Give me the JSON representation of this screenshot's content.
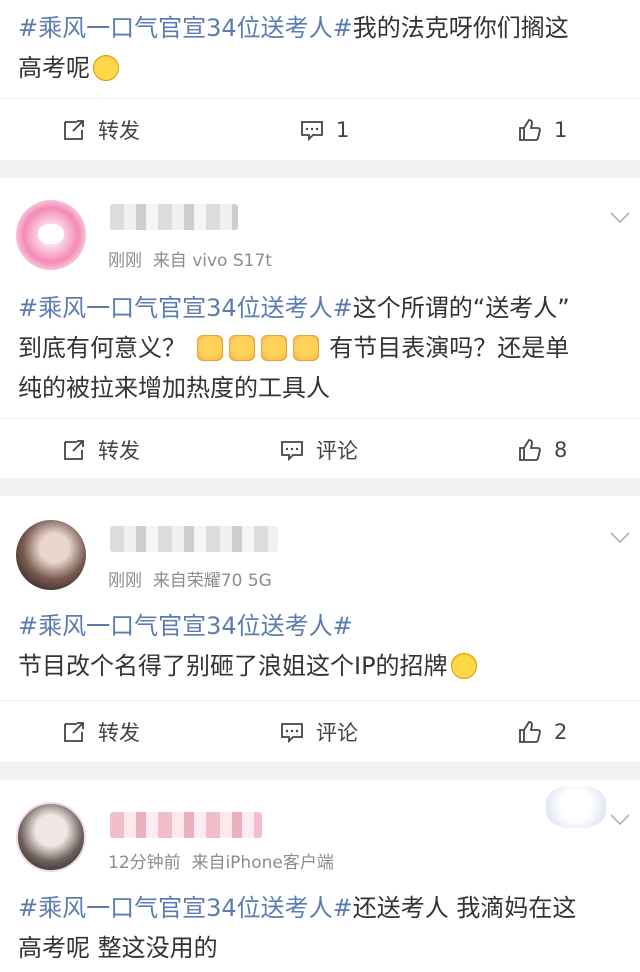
{
  "posts": [
    {
      "tag": "#乘风一口气官宣34位送考人#",
      "text_line1": "我的法克呀你们搁这",
      "text_line2": "高考呢",
      "actions": {
        "repost": "转发",
        "comment": "1",
        "like": "1"
      }
    },
    {
      "time": "刚刚",
      "source": "来自 vivo S17t",
      "tag": "#乘风一口气官宣34位送考人#",
      "text_a": "这个所谓的“送考人”",
      "text_b": "到底有何意义？",
      "text_c": "有节目表演吗？还是单",
      "text_d": "纯的被拉来增加热度的工具人",
      "actions": {
        "repost": "转发",
        "comment": "评论",
        "like": "8"
      }
    },
    {
      "time": "刚刚",
      "source": "来自荣耀70 5G",
      "tag": "#乘风一口气官宣34位送考人#",
      "text_a": "节目改个名得了别砸了浪姐这个IP的招牌",
      "actions": {
        "repost": "转发",
        "comment": "评论",
        "like": "2"
      }
    },
    {
      "time": "12分钟前",
      "source": "来自iPhone客户端",
      "tag": "#乘风一口气官宣34位送考人#",
      "text_a": "还送考人 我滴妈在这",
      "text_b": "高考呢 整这没用的"
    }
  ],
  "icons": {
    "repost": "repost-icon",
    "comment": "comment-icon",
    "like": "like-icon",
    "more": "chevron-down-icon"
  },
  "colors": {
    "tag": "#5b7cb1",
    "text": "#333333",
    "meta": "#8c8c8c",
    "background": "#f2f2f2"
  }
}
